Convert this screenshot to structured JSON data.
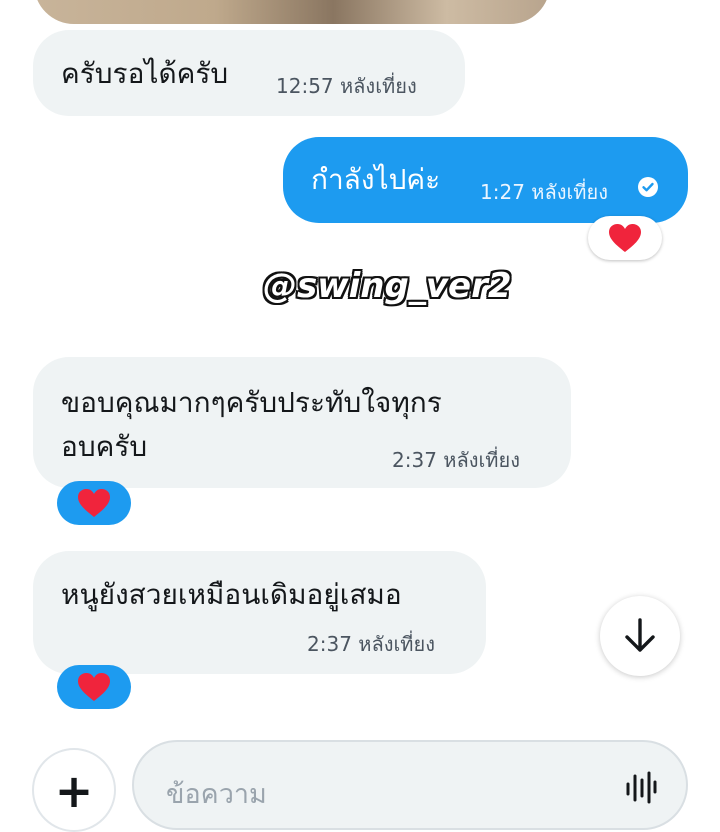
{
  "messages": [
    {
      "id": "m1",
      "direction": "incoming",
      "text": "ครับรอได้ครับ",
      "time": "12:57 หลังเที่ยง"
    },
    {
      "id": "m2",
      "direction": "outgoing",
      "text": "กำลังไปค่ะ",
      "time": "1:27 หลังเที่ยง",
      "reaction": "❤️",
      "status": "sent-check-icon"
    },
    {
      "id": "m3",
      "direction": "incoming",
      "lines": [
        "ขอบคุณมากๆครับประทับใจทุกร",
        "อบครับ"
      ],
      "time": "2:37 หลังเที่ยง",
      "reaction": "❤️"
    },
    {
      "id": "m4",
      "direction": "incoming",
      "text": "หนูยังสวยเหมือนเดิมอยู่เสมอ",
      "time": "2:37 หลังเที่ยง",
      "reaction": "❤️"
    }
  ],
  "watermark": "@swing_ver2",
  "composer": {
    "placeholder": "ข้อความ",
    "add_icon": "plus-icon",
    "voice_icon": "audio-wave-icon"
  },
  "scroll": {
    "icon": "arrow-down-icon"
  },
  "colors": {
    "accent": "#1d9bf0",
    "incoming_bubble": "#eff3f4",
    "heart": "#f0243c"
  }
}
